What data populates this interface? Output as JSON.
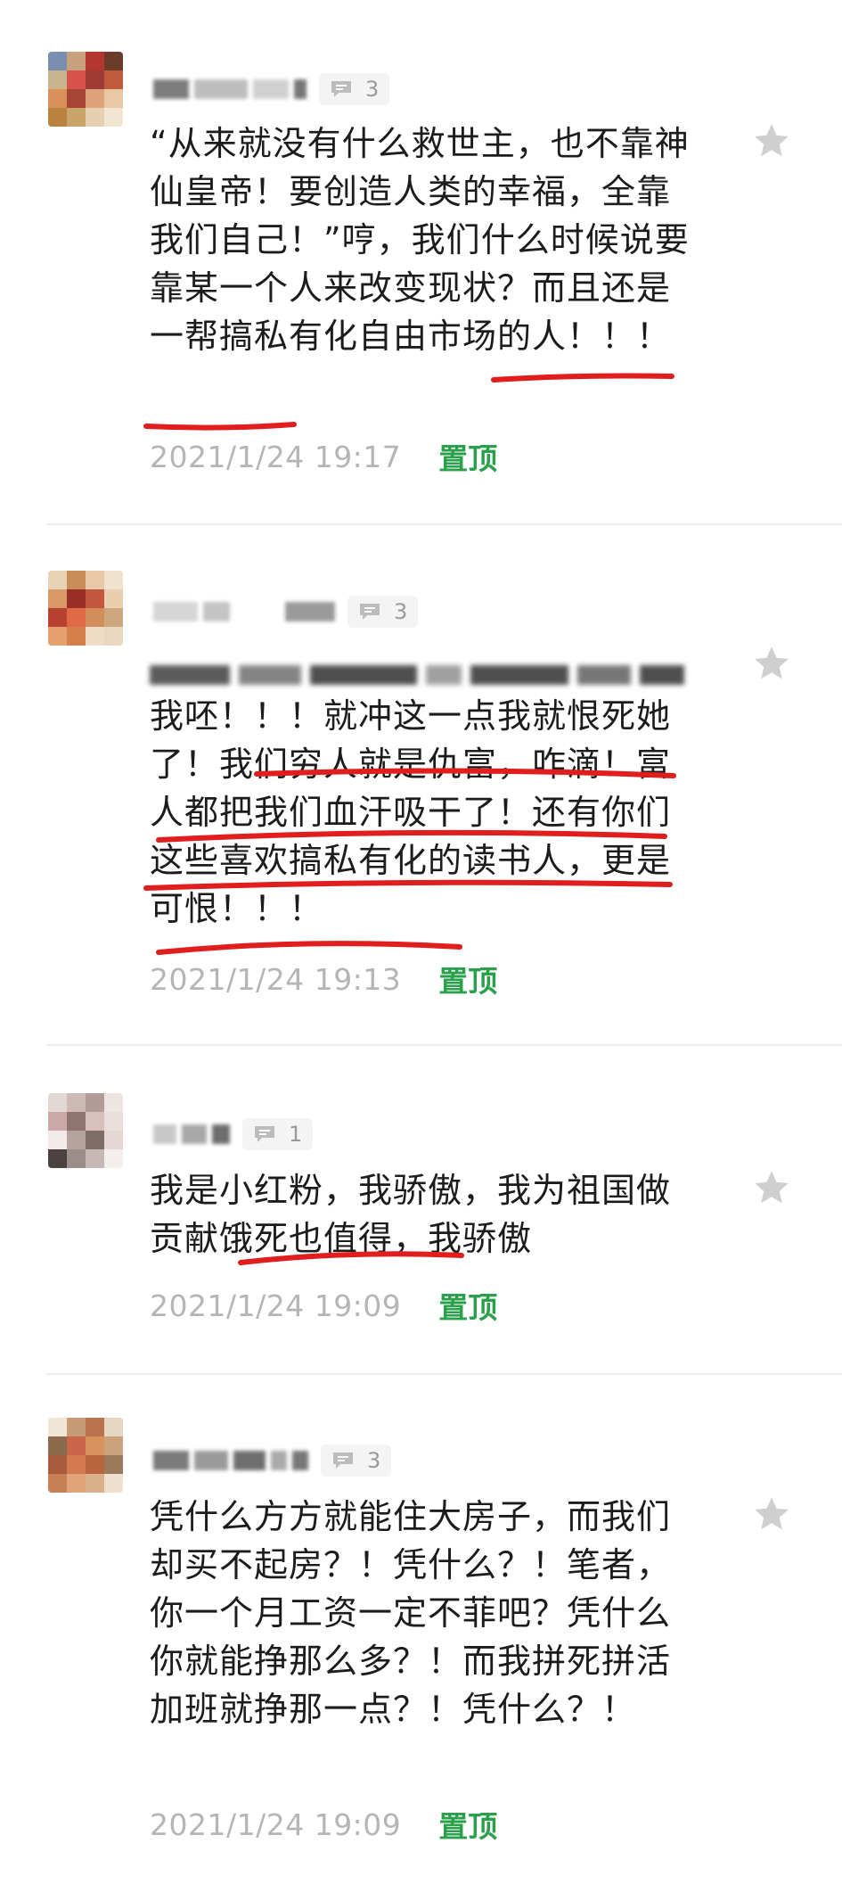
{
  "comments": [
    {
      "reply_count": "3",
      "text": "“从来就没有什么救世主，也不靠神仙皇帝！要创造人类的幸福，全靠我们自己！”哼，我们什么时候说要靠某一个人来改变现状？而且还是一帮搞私有化自由市场的人！！！",
      "time": "2021/1/24 19:17",
      "pin_label": "置顶"
    },
    {
      "reply_count": "3",
      "text": "我呸！！！就冲这一点我就恨死她了！我们穷人就是仇富，咋滴！富人都把我们血汗吸干了！还有你们这些喜欢搞私有化的读书人，更是可恨！！！",
      "time": "2021/1/24 19:13",
      "pin_label": "置顶"
    },
    {
      "reply_count": "1",
      "text": "我是小红粉，我骄傲，我为祖国做贡献饿死也值得，我骄傲",
      "time": "2021/1/24 19:09",
      "pin_label": "置顶"
    },
    {
      "reply_count": "3",
      "text": "凭什么方方就能住大房子，而我们却买不起房？！凭什么？！笔者，你一个月工资一定不菲吧？凭什么你就能挣那么多？！而我拼死拼活加班就挣那一点？！凭什么？！",
      "time": "2021/1/24 19:09",
      "pin_label": "置顶"
    }
  ],
  "colors": {
    "underline": "#e01e1e",
    "pin": "#2aa04c",
    "time": "#b5b5b5",
    "star": "#cfcfcf"
  },
  "icons": [
    "comment-bubble-icon",
    "star-icon"
  ]
}
